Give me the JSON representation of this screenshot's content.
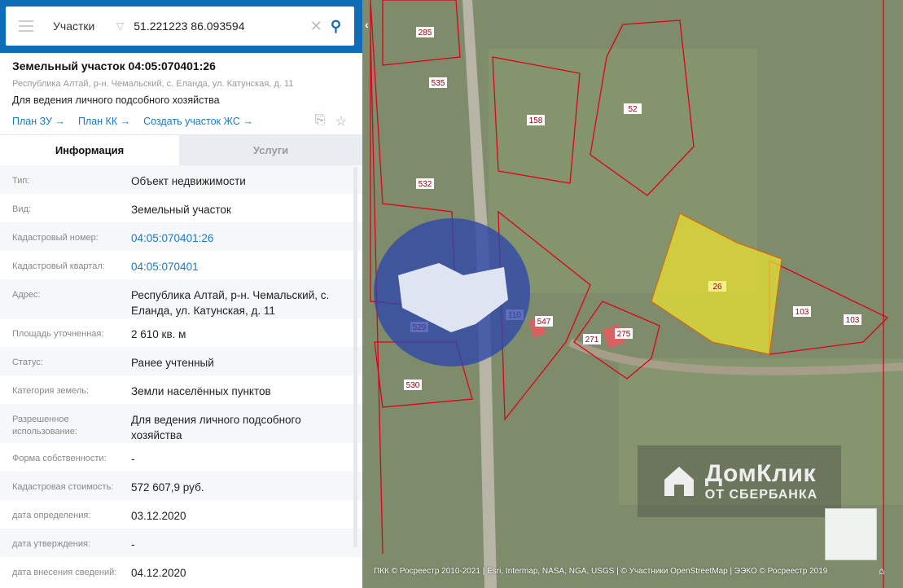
{
  "search": {
    "layer": "Участки",
    "query": "51.221223 86.093594"
  },
  "object": {
    "title": "Земельный участок 04:05:070401:26",
    "address": "Республика Алтай, р-н. Чемальский, с. Еланда, ул. Катунская, д. 11",
    "use": "Для ведения личного подсобного хозяйства",
    "links": [
      "План ЗУ →",
      "План КК →",
      "Создать участок ЖС →"
    ]
  },
  "tabs": [
    "Информация",
    "Услуги"
  ],
  "rows": [
    {
      "k": "Тип:",
      "v": "Объект недвижимости"
    },
    {
      "k": "Вид:",
      "v": "Земельный участок"
    },
    {
      "k": "Кадастровый номер:",
      "v": "04:05:070401:26"
    },
    {
      "k": "Кадастровый квартал:",
      "v": "04:05:070401"
    },
    {
      "k": "Адрес:",
      "v": "Республика Алтай, р-н. Чемальский, с. Еланда, ул. Катунская, д. 11"
    },
    {
      "k": "Площадь уточненная:",
      "v": "2 610 кв. м"
    },
    {
      "k": "Статус:",
      "v": "Ранее учтенный"
    },
    {
      "k": "Категория земель:",
      "v": "Земли населённых пунктов"
    },
    {
      "k": "Разрешенное использование:",
      "v": "Для ведения личного подсобного хозяйства"
    },
    {
      "k": "Форма собственности:",
      "v": "-"
    },
    {
      "k": "Кадастровая стоимость:",
      "v": "572 607,9 руб."
    },
    {
      "k": "дата определения:",
      "v": "03.12.2020"
    },
    {
      "k": "дата утверждения:",
      "v": "-"
    },
    {
      "k": "дата внесения сведений:",
      "v": "04.12.2020"
    }
  ],
  "map": {
    "parcels": [
      "285",
      "535",
      "158",
      "52",
      "532",
      "26",
      "103",
      "103",
      "110",
      "547",
      "271",
      "275",
      "529",
      "530"
    ],
    "watermark": {
      "logo": "ДомКлик",
      "sub": "ОТ СБЕРБАНКА"
    },
    "attribution": "ПКК © Росреестр 2010-2021 | Esri, Intermap, NASA, NGA, USGS | © Участники OpenStreetMap | ЭЭКО © Росреестр 2019"
  },
  "colors": {
    "accent": "#0f6db8",
    "parcel_border": "#e0001a",
    "selected": "#e8e030"
  }
}
